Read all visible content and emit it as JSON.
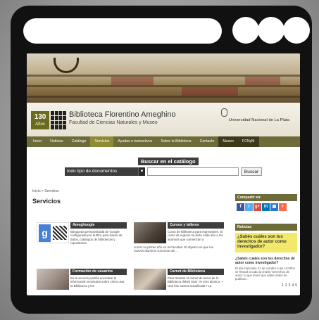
{
  "site": {
    "title": "Biblioteca Florentino Ameghino",
    "subtitle": "Facultad de Ciencias Naturales y Museo",
    "anniversary_number": "130",
    "anniversary_word": "Años",
    "university": "Universidad Nacional de La Plata"
  },
  "nav": {
    "items": [
      {
        "label": "Inicio"
      },
      {
        "label": "Noticias"
      },
      {
        "label": "Catálogo"
      },
      {
        "label": "Servicios"
      },
      {
        "label": "Ayudas e instructivos"
      },
      {
        "label": "Sobre la Biblioteca"
      },
      {
        "label": "Contacto"
      },
      {
        "label": "Museo"
      },
      {
        "label": "FCNyM"
      }
    ],
    "active": "Servicios"
  },
  "search": {
    "title": "Buscar en el catálogo",
    "select_value": "todo tipo de documentos",
    "button_label": "Buscar"
  },
  "breadcrumb": "Inicio > Servicios",
  "page_title": "Servicios",
  "services": [
    {
      "title": "Ameghoogle",
      "desc": "Búsqueda personalizada de Google configurada por la BFA para bases de datos, catálogos de bibliotecas y repositorios."
    },
    {
      "title": "Cursos y talleres",
      "desc": "Curso de Biblioteca para ingresantes. El curso de ingreso se dicta cada año a los alumnos que comienzan a",
      "desc_wide": "cursar su primer año en la Facultad. El objetivo es que los nuevos alumnos conozcan de ..."
    },
    {
      "title": "Formación de usuarios",
      "desc": "En la sección podrás encontrar la información necesaria sobre cómo usar la Biblioteca y los"
    },
    {
      "title": "Carnet de Biblioteca",
      "desc": "Para tramitar el carnet de lector de la Biblioteca debes traer: Si eres alumno: • Una foto carnet actualizada • La"
    }
  ],
  "sidebar": {
    "share_heading": "Compartir en:",
    "share_icons": [
      {
        "icon": "facebook-icon",
        "glyph": "f",
        "color": "#3b5998"
      },
      {
        "icon": "twitter-icon",
        "glyph": "t",
        "color": "#55acee"
      },
      {
        "icon": "googleplus-icon",
        "glyph": "g+",
        "color": "#dd4b39"
      },
      {
        "icon": "linkedin-icon",
        "glyph": "in",
        "color": "#0077b5"
      },
      {
        "icon": "delicious-icon",
        "glyph": "▦",
        "color": "#3274d1"
      },
      {
        "icon": "addthis-icon",
        "glyph": "+",
        "color": "#f8694d"
      }
    ],
    "news_heading": "Noticias",
    "feature": "¿Sabés cuáles son tus derechos de autor como investigador?",
    "news_title": "¿Sabés cuáles son tus derechos de autor como investigador?",
    "news_body": "El día miércoles 21 de octubre a las 12:00hs se llevará a cabo la charla \"Derechos de autor: lo que tenés que saber antes de publicar...",
    "pages": [
      "1",
      "2",
      "3",
      "4",
      "5"
    ]
  },
  "colors": {
    "nav_bg": "#6d6b3a",
    "nav_active": "#8e8a35",
    "feature_bg": "#f2e96a",
    "frame": "#111111"
  }
}
